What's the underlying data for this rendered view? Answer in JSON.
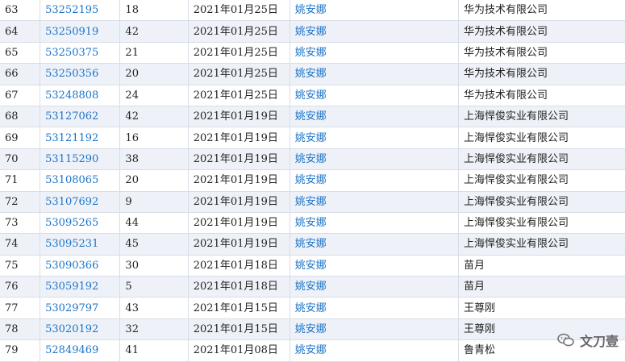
{
  "rows": [
    {
      "no": "63",
      "id": "53252195",
      "cls": "18",
      "date": "2021年01月25日",
      "agent": "姚安娜",
      "owner": "华为技术有限公司"
    },
    {
      "no": "64",
      "id": "53250919",
      "cls": "42",
      "date": "2021年01月25日",
      "agent": "姚安娜",
      "owner": "华为技术有限公司"
    },
    {
      "no": "65",
      "id": "53250375",
      "cls": "21",
      "date": "2021年01月25日",
      "agent": "姚安娜",
      "owner": "华为技术有限公司"
    },
    {
      "no": "66",
      "id": "53250356",
      "cls": "20",
      "date": "2021年01月25日",
      "agent": "姚安娜",
      "owner": "华为技术有限公司"
    },
    {
      "no": "67",
      "id": "53248808",
      "cls": "24",
      "date": "2021年01月25日",
      "agent": "姚安娜",
      "owner": "华为技术有限公司"
    },
    {
      "no": "68",
      "id": "53127062",
      "cls": "42",
      "date": "2021年01月19日",
      "agent": "姚安娜",
      "owner": "上海悍俊实业有限公司"
    },
    {
      "no": "69",
      "id": "53121192",
      "cls": "16",
      "date": "2021年01月19日",
      "agent": "姚安娜",
      "owner": "上海悍俊实业有限公司"
    },
    {
      "no": "70",
      "id": "53115290",
      "cls": "38",
      "date": "2021年01月19日",
      "agent": "姚安娜",
      "owner": "上海悍俊实业有限公司"
    },
    {
      "no": "71",
      "id": "53108065",
      "cls": "20",
      "date": "2021年01月19日",
      "agent": "姚安娜",
      "owner": "上海悍俊实业有限公司"
    },
    {
      "no": "72",
      "id": "53107692",
      "cls": "9",
      "date": "2021年01月19日",
      "agent": "姚安娜",
      "owner": "上海悍俊实业有限公司"
    },
    {
      "no": "73",
      "id": "53095265",
      "cls": "44",
      "date": "2021年01月19日",
      "agent": "姚安娜",
      "owner": "上海悍俊实业有限公司"
    },
    {
      "no": "74",
      "id": "53095231",
      "cls": "45",
      "date": "2021年01月19日",
      "agent": "姚安娜",
      "owner": "上海悍俊实业有限公司"
    },
    {
      "no": "75",
      "id": "53090366",
      "cls": "30",
      "date": "2021年01月18日",
      "agent": "姚安娜",
      "owner": "苗月"
    },
    {
      "no": "76",
      "id": "53059192",
      "cls": "5",
      "date": "2021年01月18日",
      "agent": "姚安娜",
      "owner": "苗月"
    },
    {
      "no": "77",
      "id": "53029797",
      "cls": "43",
      "date": "2021年01月15日",
      "agent": "姚安娜",
      "owner": "王尊刚"
    },
    {
      "no": "78",
      "id": "53020192",
      "cls": "32",
      "date": "2021年01月15日",
      "agent": "姚安娜",
      "owner": "王尊刚"
    },
    {
      "no": "79",
      "id": "52849469",
      "cls": "41",
      "date": "2021年01月08日",
      "agent": "姚安娜",
      "owner": "鲁青松"
    }
  ],
  "watermark": {
    "text": "文刀壹",
    "icon": "wechat-icon"
  },
  "colors": {
    "link": "#1a73c9",
    "stripe": "#eef2f8",
    "border": "#d7dde6"
  }
}
